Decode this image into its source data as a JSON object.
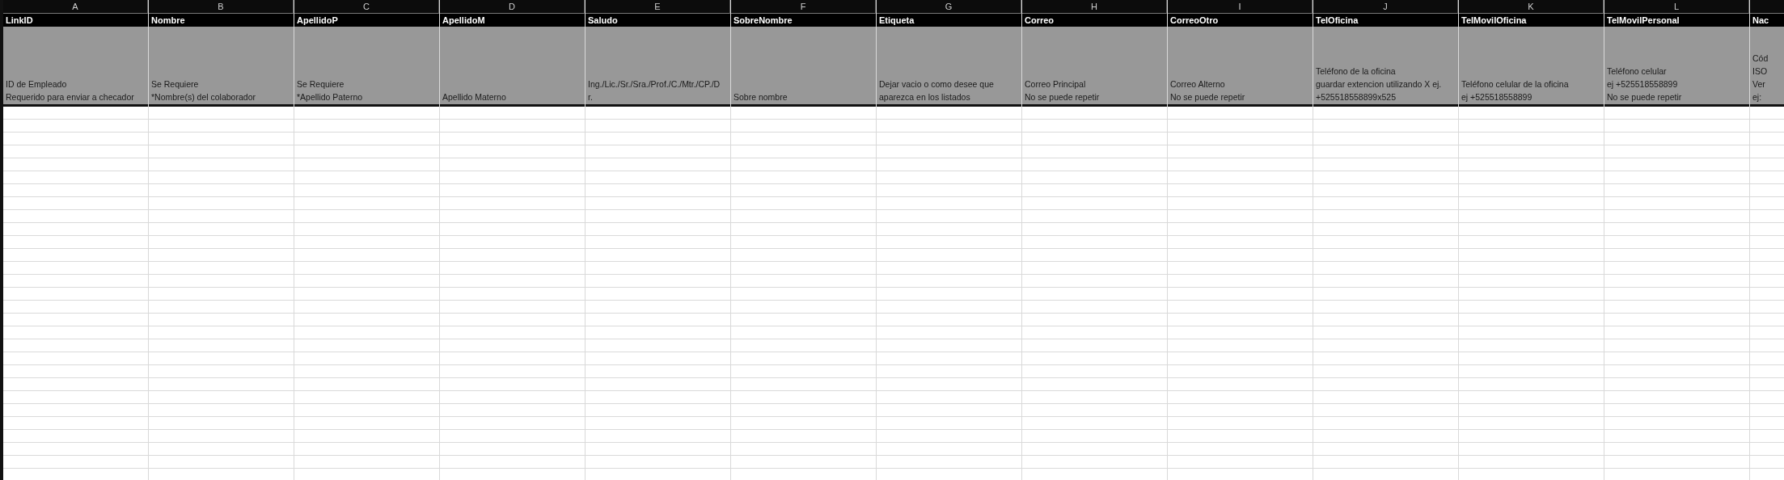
{
  "columns": [
    {
      "letter": "A",
      "heading": "LinkID",
      "description": [
        "ID de Empleado",
        "Requerido para enviar a checador"
      ]
    },
    {
      "letter": "B",
      "heading": "Nombre",
      "description": [
        "Se Requiere",
        "*Nombre(s) del colaborador"
      ]
    },
    {
      "letter": "C",
      "heading": "ApellidoP",
      "description": [
        "Se Requiere",
        "*Apellido Paterno"
      ]
    },
    {
      "letter": "D",
      "heading": "ApellidoM",
      "description": [
        "Apellido Materno"
      ]
    },
    {
      "letter": "E",
      "heading": "Saludo",
      "description": [
        "Ing./Lic./Sr./Sra./Prof./C./Mtr./CP./D",
        "r."
      ]
    },
    {
      "letter": "F",
      "heading": "SobreNombre",
      "description": [
        "Sobre nombre"
      ]
    },
    {
      "letter": "G",
      "heading": "Etiqueta",
      "description": [
        "Dejar vacio o como desee que",
        "aparezca en los listados"
      ]
    },
    {
      "letter": "H",
      "heading": "Correo",
      "description": [
        "Correo Principal",
        "No se puede repetir"
      ]
    },
    {
      "letter": "I",
      "heading": "CorreoOtro",
      "description": [
        "Correo Alterno",
        "No se puede repetir"
      ]
    },
    {
      "letter": "J",
      "heading": "TelOficina",
      "description": [
        "Teléfono de la oficina",
        "guardar extencion utilizando X ej.",
        "+525518558899x525"
      ]
    },
    {
      "letter": "K",
      "heading": "TelMovilOficina",
      "description": [
        "Teléfono celular de la oficina",
        "ej +525518558899"
      ]
    },
    {
      "letter": "L",
      "heading": "TelMovilPersonal",
      "description": [
        "Teléfono celular",
        "ej +525518558899",
        "No se puede repetir"
      ]
    },
    {
      "heading": "Nac",
      "description": [
        "Cód",
        "ISO",
        "Ver",
        "ej:"
      ]
    }
  ]
}
